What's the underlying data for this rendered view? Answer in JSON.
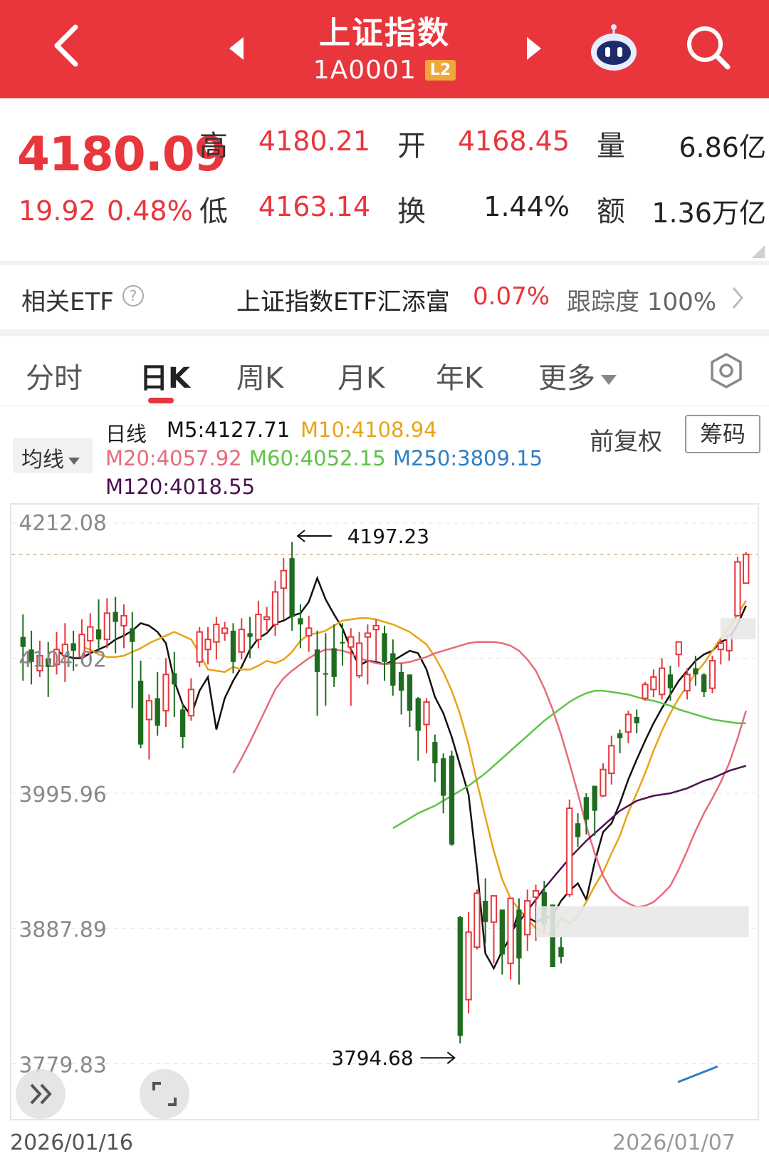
{
  "header": {
    "title": "上证指数",
    "code": "1A0001",
    "level_badge": "L2",
    "background_color": "#e8363c"
  },
  "quote": {
    "last_price": "4180.09",
    "change": "19.92",
    "change_pct": "0.48%",
    "high_label": "高",
    "high": "4180.21",
    "low_label": "低",
    "low": "4163.14",
    "open_label": "开",
    "open": "4168.45",
    "turnover_rate_label": "换",
    "turnover_rate": "1.44%",
    "volume_label": "量",
    "volume": "6.86亿",
    "amount_label": "额",
    "amount": "1.36万亿"
  },
  "etf": {
    "label": "相关ETF",
    "help_icon": "?",
    "name": "上证指数ETF汇添富",
    "change_pct": "0.07%",
    "tracking_label": "跟踪度",
    "tracking_value": "100%"
  },
  "tabs": [
    {
      "label": "分时",
      "active": false
    },
    {
      "label": "日K",
      "active": true
    },
    {
      "label": "周K",
      "active": false
    },
    {
      "label": "月K",
      "active": false
    },
    {
      "label": "年K",
      "active": false
    },
    {
      "label": "更多",
      "active": false
    }
  ],
  "indicator": {
    "ma_button": "均线",
    "period_label": "日线",
    "adjust_label": "前复权",
    "chip_button": "筹码",
    "ma": [
      {
        "label": "M5:4127.71",
        "color": "#111111"
      },
      {
        "label": "M10:4108.94",
        "color": "#e8a317"
      },
      {
        "label": "M20:4057.92",
        "color": "#e86a7a"
      },
      {
        "label": "M60:4052.15",
        "color": "#5ec447"
      },
      {
        "label": "M250:3809.15",
        "color": "#2e7fc4"
      },
      {
        "label": "M120:4018.55",
        "color": "#4a1150"
      }
    ]
  },
  "chart_data": {
    "type": "candlestick",
    "y_ticks": [
      "4212.08",
      "4104.02",
      "3995.96",
      "3887.89",
      "3779.83"
    ],
    "ylim": [
      3779.83,
      4212.08
    ],
    "max_annotation": "4197.23",
    "min_annotation": "3794.68",
    "date_start": "2026/01/16",
    "date_end": "2026/01/07",
    "up_color": "#e8363c",
    "down_color": "#1f6b1f",
    "candles": [
      [
        4121,
        4113,
        4086,
        4139
      ],
      [
        4111,
        4101,
        4083,
        4126
      ],
      [
        4094,
        4106,
        4089,
        4118
      ],
      [
        4104,
        4097,
        4073,
        4117
      ],
      [
        4099,
        4111,
        4091,
        4125
      ],
      [
        4106,
        4115,
        4085,
        4132
      ],
      [
        4116,
        4110,
        4094,
        4126
      ],
      [
        4105,
        4123,
        4100,
        4135
      ],
      [
        4118,
        4129,
        4101,
        4140
      ],
      [
        4127,
        4119,
        4109,
        4151
      ],
      [
        4119,
        4140,
        4112,
        4152
      ],
      [
        4141,
        4133,
        4108,
        4153
      ],
      [
        4130,
        4138,
        4112,
        4147
      ],
      [
        4128,
        4117,
        4064,
        4141
      ],
      [
        4086,
        4035,
        4032,
        4102
      ],
      [
        4055,
        4070,
        4023,
        4075
      ],
      [
        4072,
        4050,
        4042,
        4093
      ],
      [
        4062,
        4091,
        4049,
        4104
      ],
      [
        4092,
        4083,
        4057,
        4109
      ],
      [
        4063,
        4041,
        4032,
        4068
      ],
      [
        4058,
        4079,
        4054,
        4088
      ],
      [
        4101,
        4125,
        4097,
        4129
      ],
      [
        4111,
        4119,
        4099,
        4129
      ],
      [
        4117,
        4131,
        4103,
        4137
      ],
      [
        4124,
        4128,
        4118,
        4133
      ],
      [
        4126,
        4101,
        4092,
        4132
      ],
      [
        4109,
        4127,
        4103,
        4136
      ],
      [
        4124,
        4121,
        4104,
        4137
      ],
      [
        4119,
        4139,
        4112,
        4150
      ],
      [
        4135,
        4137,
        4126,
        4145
      ],
      [
        4131,
        4157,
        4122,
        4166
      ],
      [
        4160,
        4174,
        4135,
        4184
      ],
      [
        4184,
        4137,
        4126,
        4197
      ],
      [
        4136,
        4131,
        4112,
        4147
      ],
      [
        4122,
        4128,
        4109,
        4138
      ],
      [
        4111,
        4093,
        4058,
        4126
      ],
      [
        4092,
        4091,
        4066,
        4124
      ],
      [
        4112,
        4089,
        4081,
        4131
      ],
      [
        4117,
        4116,
        4098,
        4132
      ],
      [
        4113,
        4121,
        4066,
        4128
      ],
      [
        4090,
        4116,
        4088,
        4125
      ],
      [
        4121,
        4124,
        4083,
        4131
      ],
      [
        4127,
        4130,
        4102,
        4135
      ],
      [
        4124,
        4101,
        4086,
        4130
      ],
      [
        4108,
        4082,
        4074,
        4119
      ],
      [
        4093,
        4078,
        4059,
        4100
      ],
      [
        4091,
        4062,
        4049,
        4088
      ],
      [
        4072,
        4046,
        4022,
        4073
      ],
      [
        4051,
        4069,
        4028,
        4072
      ],
      [
        4037,
        4020,
        4005,
        4043
      ],
      [
        4024,
        3994,
        3980,
        4028
      ],
      [
        4026,
        3955,
        3954,
        4030
      ],
      [
        3897,
        3802,
        3796,
        3898
      ],
      [
        3831,
        3885,
        3820,
        3901
      ],
      [
        3873,
        3916,
        3871,
        3919
      ],
      [
        3910,
        3893,
        3876,
        3928
      ],
      [
        3893,
        3914,
        3860,
        3903
      ],
      [
        3903,
        3867,
        3851,
        3902
      ],
      [
        3860,
        3912,
        3847,
        3897
      ],
      [
        3903,
        3864,
        3843,
        3912
      ],
      [
        3883,
        3910,
        3870,
        3919
      ],
      [
        3913,
        3918,
        3878,
        3923
      ],
      [
        3917,
        3891,
        3886,
        3926
      ],
      [
        3907,
        3857,
        3858,
        3904
      ],
      [
        3873,
        3865,
        3860,
        3882
      ],
      [
        3915,
        3984,
        3913,
        3991
      ],
      [
        3972,
        3961,
        3953,
        3980
      ],
      [
        3993,
        3975,
        3963,
        3996
      ],
      [
        4002,
        3982,
        3962,
        3990
      ],
      [
        3994,
        4015,
        3993,
        4020
      ],
      [
        4012,
        4034,
        4003,
        4042
      ],
      [
        4044,
        4040,
        4028,
        4047
      ],
      [
        4045,
        4059,
        4036,
        4062
      ],
      [
        4057,
        4052,
        4044,
        4063
      ],
      [
        4072,
        4083,
        4070,
        4085
      ],
      [
        4079,
        4089,
        4073,
        4095
      ],
      [
        4075,
        4096,
        4071,
        4104
      ],
      [
        4091,
        4080,
        4070,
        4098
      ],
      [
        4107,
        4117,
        4097,
        4111
      ],
      [
        4078,
        4091,
        4071,
        4096
      ],
      [
        4096,
        4091,
        4082,
        4106
      ],
      [
        4091,
        4077,
        4073,
        4092
      ],
      [
        4080,
        4102,
        4076,
        4106
      ],
      [
        4111,
        4116,
        4099,
        4119
      ],
      [
        4110,
        4122,
        4102,
        4118
      ],
      [
        4138,
        4181,
        4140,
        4185
      ],
      [
        4164,
        4187,
        4172,
        4189
      ]
    ],
    "ma_lines": [
      {
        "name": "M5",
        "color": "#111111",
        "values": [
          4110,
          4106,
          4104,
          4104,
          4108,
          4111,
          4114,
          4119,
          4122,
          4126,
          4132,
          4130,
          4125,
          4116,
          4086,
          4067,
          4058,
          4078,
          4089,
          4047,
          4072,
          4086,
          4097,
          4111,
          4120,
          4124,
          4132,
          4134,
          4138,
          4140,
          4149,
          4168,
          4151,
          4139,
          4128,
          4111,
          4098,
          4102,
          4101,
          4099,
          4102,
          4106,
          4110,
          4108,
          4095,
          4073,
          4060,
          4041,
          4018,
          3995,
          3936,
          3868,
          3856,
          3870,
          3881,
          3902,
          3897,
          3893,
          3896,
          3898,
          3910,
          3918,
          3924,
          3911,
          3941,
          3965,
          3972,
          3988,
          4007,
          4023,
          4038,
          4052,
          4064,
          4075,
          4086,
          4094,
          4102,
          4107,
          4110,
          4117,
          4120,
          4131,
          4146
        ]
      },
      {
        "name": "M10",
        "color": "#e8a317",
        "values": [
          4113,
          4111,
          4107,
          4105,
          4105,
          4106,
          4109,
          4112,
          4116,
          4119,
          4122,
          4125,
          4122,
          4119,
          4108,
          4095,
          4094,
          4093,
          4097,
          4095,
          4095,
          4098,
          4102,
          4100,
          4103,
          4109,
          4118,
          4123,
          4124,
          4126,
          4130,
          4134,
          4135,
          4136,
          4136,
          4135,
          4133,
          4131,
          4128,
          4125,
          4120,
          4115,
          4105,
          4093,
          4078,
          4059,
          4035,
          4005,
          3977,
          3950,
          3927,
          3912,
          3903,
          3895,
          3888,
          3884,
          3884,
          3896,
          3892,
          3898,
          3909,
          3922,
          3933,
          3948,
          3962,
          3981,
          3996,
          4012,
          4030,
          4046,
          4060,
          4072,
          4082,
          4092,
          4100,
          4110,
          4120,
          4129,
          4139,
          4150
        ]
      },
      {
        "name": "M20",
        "color": "#e86a7a",
        "values": [
          4012,
          4024,
          4037,
          4051,
          4065,
          4079,
          4088,
          4094,
          4099,
          4104,
          4108,
          4111,
          4111,
          4110,
          4108,
          4104,
          4102,
          4100,
          4099,
          4100,
          4100,
          4101,
          4103,
          4105,
          4108,
          4110,
          4112,
          4114,
          4116,
          4117,
          4117,
          4117,
          4116,
          4114,
          4110,
          4103,
          4094,
          4080,
          4063,
          4043,
          4020,
          3996,
          3970,
          3948,
          3930,
          3918,
          3912,
          3908,
          3905,
          3906,
          3909,
          3915,
          3922,
          3935,
          3950,
          3966,
          3980,
          3992,
          4005,
          4020,
          4040,
          4062
        ]
      },
      {
        "name": "M60",
        "color": "#5ec447",
        "values": [
          3968,
          3972,
          3976,
          3980,
          3983,
          3986,
          3990,
          3994,
          3998,
          4002,
          4007,
          4012,
          4018,
          4024,
          4030,
          4036,
          4042,
          4048,
          4054,
          4059,
          4064,
          4069,
          4073,
          4076,
          4078,
          4078,
          4077,
          4076,
          4075,
          4073,
          4071,
          4070,
          4068,
          4066,
          4063,
          4061,
          4059,
          4057,
          4055,
          4054,
          4053,
          4052,
          4052
        ]
      },
      {
        "name": "M120",
        "color": "#4a1150",
        "values": [
          3885,
          3893,
          3902,
          3911,
          3920,
          3928,
          3936,
          3944,
          3951,
          3958,
          3964,
          3970,
          3976,
          3982,
          3986,
          3990,
          3992,
          3994,
          3995,
          3996,
          3998,
          4000,
          4003,
          4006,
          4008,
          4011,
          4014,
          4016,
          4018
        ]
      }
    ]
  },
  "chart_buttons": {
    "expand_icon": "double-chevron-right-icon",
    "fullscreen_icon": "fullscreen-icon"
  }
}
